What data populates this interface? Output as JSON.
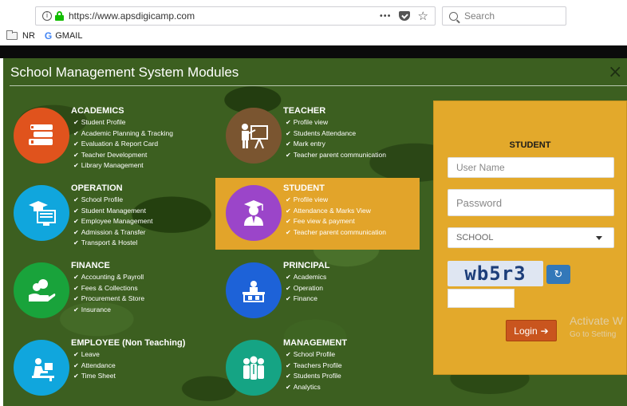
{
  "browser": {
    "url": "https://www.apsdigicamp.com",
    "search_placeholder": "Search",
    "menu_dots": "•••",
    "star": "☆",
    "bookmarks": [
      {
        "label": "NR",
        "icon": "folder-icon"
      },
      {
        "label": "GMAIL",
        "icon": "google-icon"
      }
    ]
  },
  "modal": {
    "title": "School Management System Modules",
    "close": "×"
  },
  "modules": [
    {
      "name": "ACADEMICS",
      "color": "#e0531d",
      "icon": "books-icon",
      "items": [
        "Student Profile",
        "Academic Planning & Tracking",
        "Evaluation & Report Card",
        "Teacher Development",
        "Library Management"
      ]
    },
    {
      "name": "TEACHER",
      "color": "#7a5530",
      "icon": "teacher-board-icon",
      "items": [
        "Profile view",
        "Students Attendance",
        "Mark entry",
        "Teacher parent communication"
      ]
    },
    {
      "name": "OPERATION",
      "color": "#10a6dd",
      "icon": "graduate-computer-icon",
      "items": [
        "School Profile",
        "Student Management",
        "Employee Management",
        "Admission & Transfer",
        "Transport & Hostel"
      ]
    },
    {
      "name": "STUDENT",
      "color": "#9b45c9",
      "icon": "student-graduate-icon",
      "items": [
        "Profile view",
        "Attendance & Marks View",
        "Fee view & payment",
        "Teacher parent communication"
      ]
    },
    {
      "name": "FINANCE",
      "color": "#19a33b",
      "icon": "money-hand-icon",
      "items": [
        "Accounting & Payroll",
        "Fees & Collections",
        "Procurement & Store",
        "Insurance"
      ]
    },
    {
      "name": "PRINCIPAL",
      "color": "#1d62d8",
      "icon": "principal-desk-icon",
      "items": [
        "Academics",
        "Operation",
        "Finance"
      ]
    },
    {
      "name": "EMPLOYEE (Non Teaching)",
      "color": "#10a6dd",
      "icon": "employee-desk-icon",
      "items": [
        "Leave",
        "Attendance",
        "Time Sheet"
      ]
    },
    {
      "name": "MANAGEMENT",
      "color": "#15a484",
      "icon": "group-icon",
      "items": [
        "School Profile",
        "Teachers Profile",
        "Students Profile",
        "Analytics"
      ]
    }
  ],
  "login": {
    "heading": "STUDENT",
    "username_placeholder": "User Name",
    "password_placeholder": "Password",
    "school_select": "SCHOOL",
    "captcha": "wb5r3",
    "refresh": "↻",
    "button": "Login",
    "button_arrow": "➔"
  },
  "watermark": {
    "line1": "Activate W",
    "line2": "Go to Setting"
  }
}
